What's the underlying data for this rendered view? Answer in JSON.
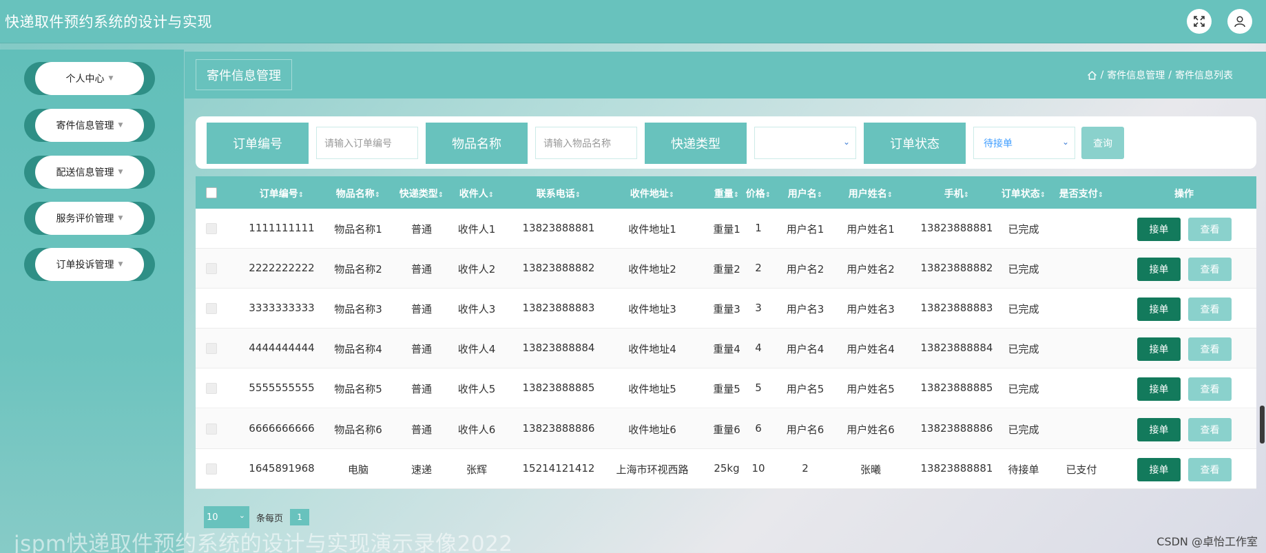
{
  "header": {
    "app_title": "快递取件预约系统的设计与实现"
  },
  "sidebar": {
    "items": [
      {
        "label": "个人中心"
      },
      {
        "label": "寄件信息管理"
      },
      {
        "label": "配送信息管理"
      },
      {
        "label": "服务评价管理"
      },
      {
        "label": "订单投诉管理"
      }
    ]
  },
  "page": {
    "title": "寄件信息管理",
    "breadcrumb": [
      "寄件信息管理",
      "寄件信息列表"
    ]
  },
  "search": {
    "order_no_label": "订单编号",
    "order_no_placeholder": "请输入订单编号",
    "item_name_label": "物品名称",
    "item_name_placeholder": "请输入物品名称",
    "express_type_label": "快递类型",
    "express_type_value": "",
    "order_status_label": "订单状态",
    "order_status_value": "待接单",
    "query_label": "查询"
  },
  "table": {
    "headers": [
      "订单编号",
      "物品名称",
      "快递类型",
      "收件人",
      "联系电话",
      "收件地址",
      "重量",
      "价格",
      "用户名",
      "用户姓名",
      "手机",
      "订单状态",
      "是否支付",
      "操作"
    ],
    "rows": [
      [
        "1111111111",
        "物品名称1",
        "普通",
        "收件人1",
        "13823888881",
        "收件地址1",
        "重量1",
        "1",
        "用户名1",
        "用户姓名1",
        "13823888881",
        "已完成",
        ""
      ],
      [
        "2222222222",
        "物品名称2",
        "普通",
        "收件人2",
        "13823888882",
        "收件地址2",
        "重量2",
        "2",
        "用户名2",
        "用户姓名2",
        "13823888882",
        "已完成",
        ""
      ],
      [
        "3333333333",
        "物品名称3",
        "普通",
        "收件人3",
        "13823888883",
        "收件地址3",
        "重量3",
        "3",
        "用户名3",
        "用户姓名3",
        "13823888883",
        "已完成",
        ""
      ],
      [
        "4444444444",
        "物品名称4",
        "普通",
        "收件人4",
        "13823888884",
        "收件地址4",
        "重量4",
        "4",
        "用户名4",
        "用户姓名4",
        "13823888884",
        "已完成",
        ""
      ],
      [
        "5555555555",
        "物品名称5",
        "普通",
        "收件人5",
        "13823888885",
        "收件地址5",
        "重量5",
        "5",
        "用户名5",
        "用户姓名5",
        "13823888885",
        "已完成",
        ""
      ],
      [
        "6666666666",
        "物品名称6",
        "普通",
        "收件人6",
        "13823888886",
        "收件地址6",
        "重量6",
        "6",
        "用户名6",
        "用户姓名6",
        "13823888886",
        "已完成",
        ""
      ],
      [
        "1645891968",
        "电脑",
        "速递",
        "张辉",
        "15214121412",
        "上海市环视西路",
        "25kg",
        "10",
        "2",
        "张曦",
        "13823888881",
        "待接单",
        "已支付"
      ]
    ],
    "accept_label": "接单",
    "view_label": "查看"
  },
  "pagination": {
    "page_size": "10",
    "per_page_label": "条每页",
    "current_page": "1"
  },
  "overlay": {
    "watermark": "jspm快递取件预约系统的设计与实现演示录像2022",
    "credit": "CSDN @卓怡工作室"
  },
  "colors": {
    "primary": "#68c2bd",
    "accept_button": "#137a5c",
    "view_button": "#8ad1cc"
  }
}
